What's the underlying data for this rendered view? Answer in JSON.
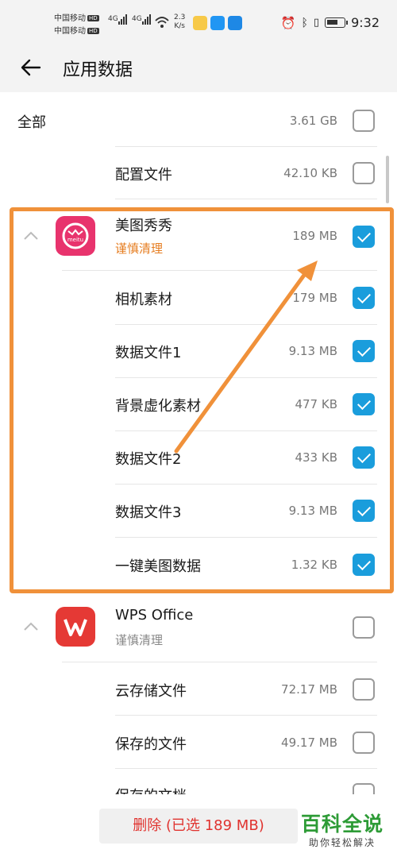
{
  "status_bar": {
    "carrier1": "中国移动",
    "carrier2": "中国移动",
    "hd": "HD",
    "sig1": "4G",
    "sig2": "4G",
    "speed_value": "2.3",
    "speed_unit": "K/s",
    "time": "9:32"
  },
  "header": {
    "title": "应用数据"
  },
  "rows": {
    "all": {
      "label": "全部",
      "size": "3.61 GB",
      "checked": false
    },
    "config": {
      "label": "配置文件",
      "size": "42.10 KB",
      "checked": false
    },
    "meitu": {
      "label": "美图秀秀",
      "sub": "谨慎清理",
      "size": "189 MB",
      "checked": true,
      "icon_text": "meitu"
    },
    "camera": {
      "label": "相机素材",
      "size": "179 MB",
      "checked": true
    },
    "data1": {
      "label": "数据文件1",
      "size": "9.13 MB",
      "checked": true
    },
    "bgblur": {
      "label": "背景虚化素材",
      "size": "477 KB",
      "checked": true
    },
    "data2": {
      "label": "数据文件2",
      "size": "433 KB",
      "checked": true
    },
    "data3": {
      "label": "数据文件3",
      "size": "9.13 MB",
      "checked": true
    },
    "onekey": {
      "label": "一键美图数据",
      "size": "1.32 KB",
      "checked": true
    },
    "wps": {
      "label": "WPS Office",
      "sub": "谨慎清理",
      "checked": false
    },
    "cloud": {
      "label": "云存储文件",
      "size": "72.17 MB",
      "checked": false
    },
    "saved": {
      "label": "保存的文件",
      "size": "49.17 MB",
      "checked": false
    },
    "partial": {
      "label": "保存的文档"
    }
  },
  "bottom": {
    "delete_label": "删除 (已选 189 MB)"
  },
  "watermark": {
    "main": "百科全说",
    "sub": "助你轻松解决"
  },
  "colors": {
    "accent": "#1a9ddc",
    "warning": "#e67e22",
    "highlight": "#f0913a",
    "delete": "#e0332f",
    "meitu": "#e8336d",
    "wps": "#e53935"
  }
}
